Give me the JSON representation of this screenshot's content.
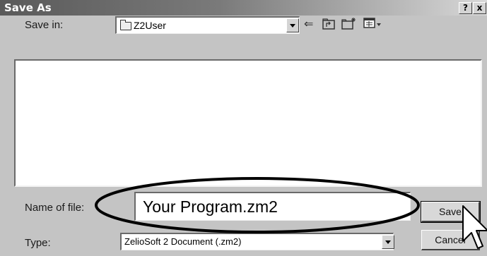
{
  "title": "Save As",
  "title_buttons": {
    "help": "?",
    "close": "x"
  },
  "save_in": {
    "label": "Save in:",
    "value": "Z2User"
  },
  "toolbar": {
    "back_icon": "back-arrow-icon",
    "up_icon": "up-folder-icon",
    "new_folder_icon": "new-folder-icon",
    "view_icon": "view-menu-icon"
  },
  "file_name": {
    "label": "Name of file:",
    "value": "Your Program.zm2"
  },
  "file_type": {
    "label": "Type:",
    "value": "ZelioSoft 2 Document (.zm2)"
  },
  "buttons": {
    "save": "Save",
    "cancel": "Cancel"
  }
}
